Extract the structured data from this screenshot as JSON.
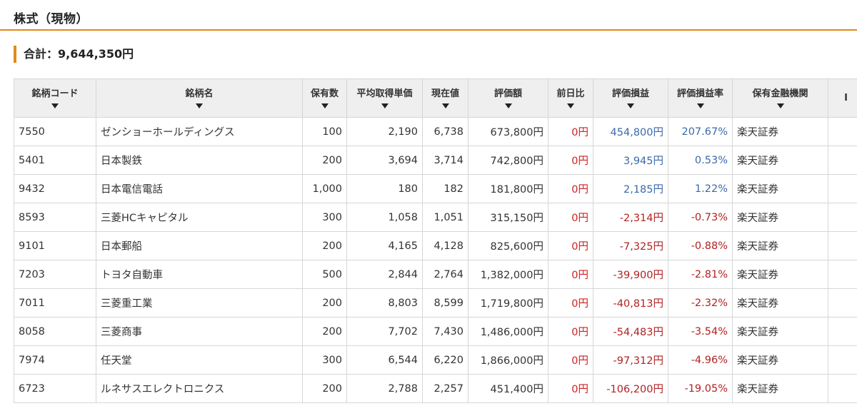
{
  "section": {
    "title": "株式（現物）"
  },
  "summary": {
    "total_label": "合計：9,644,350円"
  },
  "table": {
    "columns": [
      "銘柄コード",
      "銘柄名",
      "保有数",
      "平均取得単価",
      "現在値",
      "評価額",
      "前日比",
      "評価損益",
      "評価損益率",
      "保有金融機関",
      "I"
    ],
    "rows": [
      {
        "code": "7550",
        "name": "ゼンショーホールディングス",
        "shares": "100",
        "avg_cost": "2,190",
        "price": "6,738",
        "value": "673,800円",
        "day_change": "0円",
        "pl": "454,800円",
        "pl_rate": "207.67%",
        "broker": "楽天証券",
        "trend": "pos"
      },
      {
        "code": "5401",
        "name": "日本製鉄",
        "shares": "200",
        "avg_cost": "3,694",
        "price": "3,714",
        "value": "742,800円",
        "day_change": "0円",
        "pl": "3,945円",
        "pl_rate": "0.53%",
        "broker": "楽天証券",
        "trend": "pos"
      },
      {
        "code": "9432",
        "name": "日本電信電話",
        "shares": "1,000",
        "avg_cost": "180",
        "price": "182",
        "value": "181,800円",
        "day_change": "0円",
        "pl": "2,185円",
        "pl_rate": "1.22%",
        "broker": "楽天証券",
        "trend": "pos"
      },
      {
        "code": "8593",
        "name": "三菱HCキャピタル",
        "shares": "300",
        "avg_cost": "1,058",
        "price": "1,051",
        "value": "315,150円",
        "day_change": "0円",
        "pl": "-2,314円",
        "pl_rate": "-0.73%",
        "broker": "楽天証券",
        "trend": "neg"
      },
      {
        "code": "9101",
        "name": "日本郵船",
        "shares": "200",
        "avg_cost": "4,165",
        "price": "4,128",
        "value": "825,600円",
        "day_change": "0円",
        "pl": "-7,325円",
        "pl_rate": "-0.88%",
        "broker": "楽天証券",
        "trend": "neg"
      },
      {
        "code": "7203",
        "name": "トヨタ自動車",
        "shares": "500",
        "avg_cost": "2,844",
        "price": "2,764",
        "value": "1,382,000円",
        "day_change": "0円",
        "pl": "-39,900円",
        "pl_rate": "-2.81%",
        "broker": "楽天証券",
        "trend": "neg"
      },
      {
        "code": "7011",
        "name": "三菱重工業",
        "shares": "200",
        "avg_cost": "8,803",
        "price": "8,599",
        "value": "1,719,800円",
        "day_change": "0円",
        "pl": "-40,813円",
        "pl_rate": "-2.32%",
        "broker": "楽天証券",
        "trend": "neg"
      },
      {
        "code": "8058",
        "name": "三菱商事",
        "shares": "200",
        "avg_cost": "7,702",
        "price": "7,430",
        "value": "1,486,000円",
        "day_change": "0円",
        "pl": "-54,483円",
        "pl_rate": "-3.54%",
        "broker": "楽天証券",
        "trend": "neg"
      },
      {
        "code": "7974",
        "name": "任天堂",
        "shares": "300",
        "avg_cost": "6,544",
        "price": "6,220",
        "value": "1,866,000円",
        "day_change": "0円",
        "pl": "-97,312円",
        "pl_rate": "-4.96%",
        "broker": "楽天証券",
        "trend": "neg"
      },
      {
        "code": "6723",
        "name": "ルネサスエレクトロニクス",
        "shares": "200",
        "avg_cost": "2,788",
        "price": "2,257",
        "value": "451,400円",
        "day_change": "0円",
        "pl": "-106,200円",
        "pl_rate": "-19.05%",
        "broker": "楽天証券",
        "trend": "neg"
      }
    ]
  },
  "colors": {
    "accent": "#e08a1c",
    "positive": "#3b6aa8",
    "negative": "#b22222",
    "day_change": "#d22020",
    "header_bg": "#efefef"
  },
  "icons": {
    "sort": "sort-desc-icon"
  }
}
